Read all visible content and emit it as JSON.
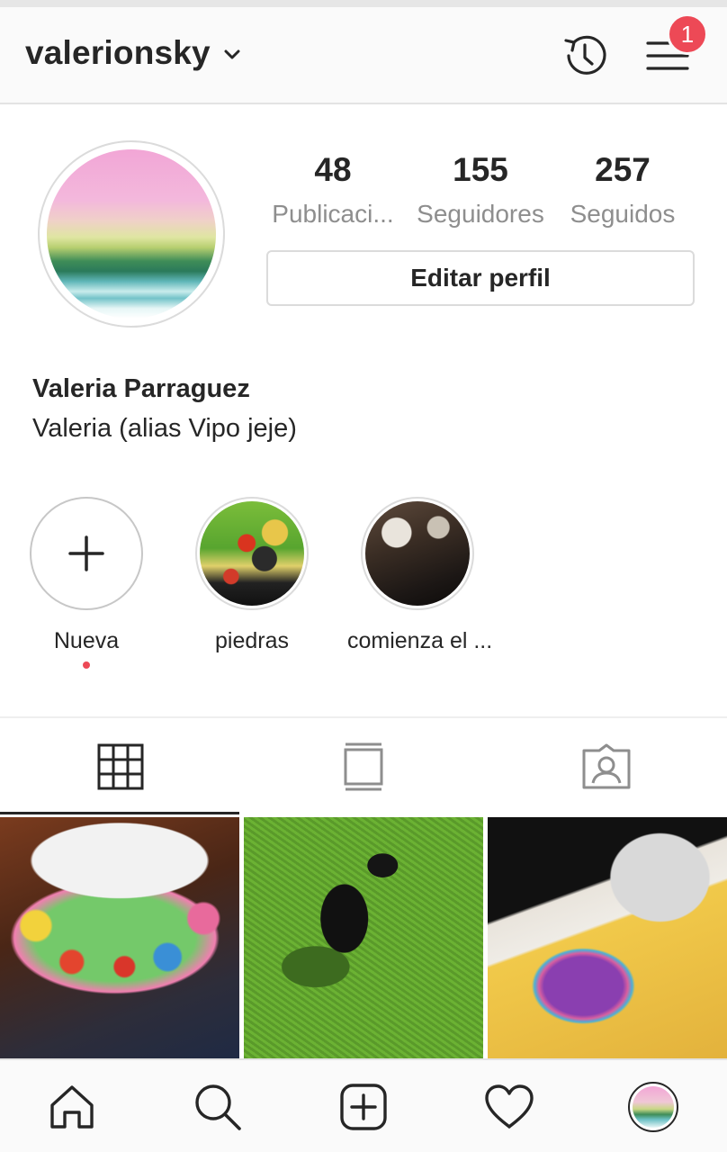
{
  "header": {
    "username": "valerionsky",
    "notification_count": "1"
  },
  "profile": {
    "stats": [
      {
        "value": "48",
        "label": "Publicaci..."
      },
      {
        "value": "155",
        "label": "Seguidores"
      },
      {
        "value": "257",
        "label": "Seguidos"
      }
    ],
    "edit_label": "Editar perfil",
    "full_name": "Valeria Parraguez",
    "bio": "Valeria (alias Vipo jeje)"
  },
  "highlights": [
    {
      "label": "Nueva"
    },
    {
      "label": "piedras"
    },
    {
      "label": "comienza el ..."
    }
  ],
  "tabs": [
    "grid",
    "feed",
    "tagged"
  ],
  "colors": {
    "accent_red": "#ed4956",
    "text": "#262626",
    "muted": "#8e8e8e"
  },
  "icons": [
    "chevron-down-icon",
    "history-icon",
    "menu-icon",
    "plus-icon",
    "grid-icon",
    "feed-icon",
    "tagged-icon",
    "home-icon",
    "search-icon",
    "add-post-icon",
    "heart-icon"
  ]
}
